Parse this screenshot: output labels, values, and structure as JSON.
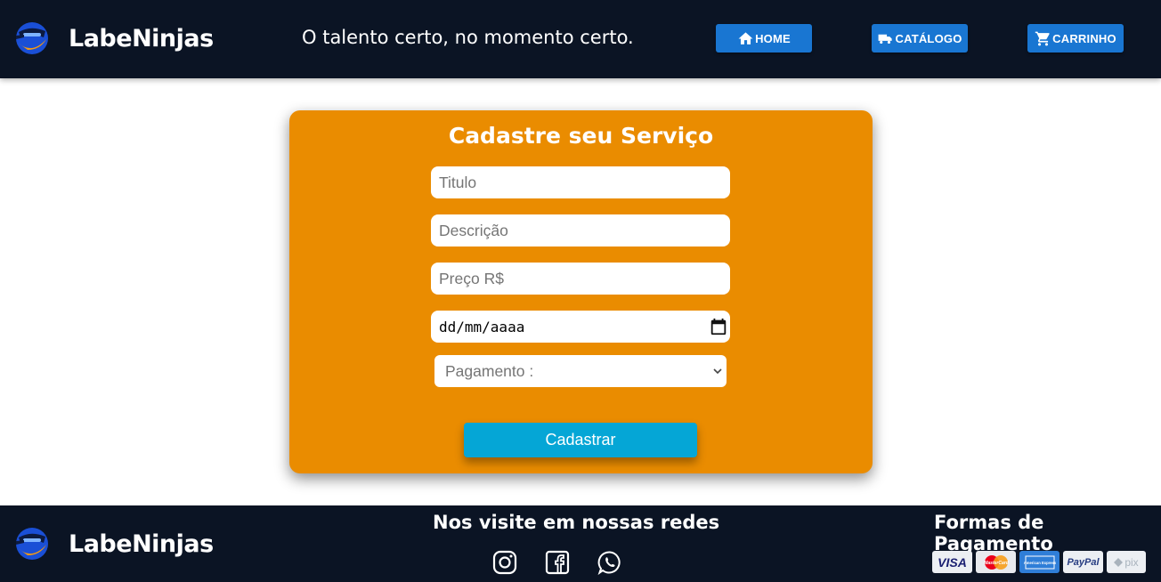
{
  "header": {
    "brand": "LabeNinjas",
    "slogan": "O talento certo, no momento certo.",
    "nav": [
      {
        "label": "HOME",
        "icon": "home-icon"
      },
      {
        "label": "CATÁLOGO",
        "icon": "truck-icon"
      },
      {
        "label": "CARRINHO",
        "icon": "cart-icon"
      }
    ]
  },
  "form": {
    "title": "Cadastre seu Serviço",
    "titulo_placeholder": "Titulo",
    "descricao_placeholder": "Descrição",
    "preco_placeholder": "Preço R$",
    "date_placeholder": "dd/mm/aaaa",
    "pagamento_selected": "Pagamento :",
    "submit_label": "Cadastrar"
  },
  "footer": {
    "brand": "LabeNinjas",
    "social_heading": "Nos visite em nossas redes",
    "social": [
      "instagram-icon",
      "facebook-icon",
      "whatsapp-icon"
    ],
    "payment_heading": "Formas de Pagamento",
    "payments": [
      "VISA",
      "MasterCard",
      "American Express",
      "PayPal",
      "pix"
    ]
  },
  "colors": {
    "header_bg": "#0b1424",
    "nav_button": "#1976d2",
    "card_bg": "#ea8c00",
    "submit_button": "#05a6d6"
  }
}
